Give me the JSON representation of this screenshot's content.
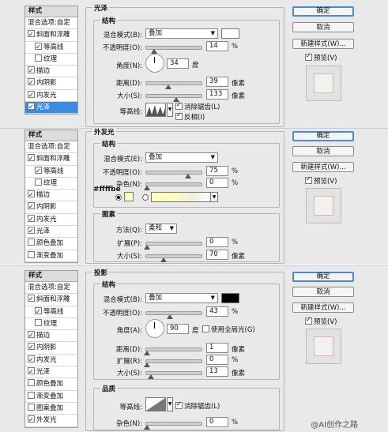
{
  "panel1": {
    "styles_title": "样式",
    "blend_options": "混合选项:自定",
    "items": [
      {
        "label": "斜面和浮雕",
        "checked": true
      },
      {
        "label": "等高线",
        "checked": true
      },
      {
        "label": "纹理",
        "checked": false
      },
      {
        "label": "描边",
        "checked": true
      },
      {
        "label": "内阴影",
        "checked": true
      },
      {
        "label": "内发光",
        "checked": true
      },
      {
        "label": "光泽",
        "checked": true,
        "selected": true
      }
    ],
    "section": "光泽",
    "group": "结构",
    "blend_mode_label": "混合模式(B):",
    "blend_mode": "叠加",
    "opacity_label": "不透明度(O):",
    "opacity": "14",
    "angle_label": "角度(N):",
    "angle": "34",
    "angle_unit": "度",
    "distance_label": "距离(D):",
    "distance": "39",
    "size_label": "大小(S):",
    "size": "133",
    "px_unit": "像素",
    "pct_unit": "%",
    "contour_label": "等高线:",
    "antialias": "消除锯齿(L)",
    "invert": "反相(I)"
  },
  "panel2": {
    "styles_title": "样式",
    "blend_options": "混合选项:自定",
    "items": [
      {
        "label": "斜面和浮雕",
        "checked": true
      },
      {
        "label": "等高线",
        "checked": true
      },
      {
        "label": "纹理",
        "checked": false
      },
      {
        "label": "描边",
        "checked": true
      },
      {
        "label": "内阴影",
        "checked": true
      },
      {
        "label": "内发光",
        "checked": true
      },
      {
        "label": "光泽",
        "checked": true
      },
      {
        "label": "颜色叠加",
        "checked": false
      },
      {
        "label": "渐变叠加",
        "checked": false
      }
    ],
    "section": "外发光",
    "group": "结构",
    "blend_mode_label": "混合模式(E):",
    "blend_mode": "叠加",
    "opacity_label": "不透明度(O):",
    "opacity": "75",
    "noise_label": "杂色(N):",
    "noise": "0",
    "hex": "#ffffbe",
    "group2": "图素",
    "method_label": "方法(Q):",
    "method": "柔和",
    "spread_label": "扩展(P):",
    "spread": "0",
    "size_label": "大小(S):",
    "size": "70",
    "px_unit": "像素",
    "pct_unit": "%"
  },
  "panel3": {
    "styles_title": "样式",
    "blend_options": "混合选项:自定",
    "items": [
      {
        "label": "斜面和浮雕",
        "checked": true
      },
      {
        "label": "等高线",
        "checked": true
      },
      {
        "label": "纹理",
        "checked": false
      },
      {
        "label": "描边",
        "checked": true
      },
      {
        "label": "内阴影",
        "checked": true
      },
      {
        "label": "内发光",
        "checked": true
      },
      {
        "label": "光泽",
        "checked": true
      },
      {
        "label": "颜色叠加",
        "checked": false
      },
      {
        "label": "渐变叠加",
        "checked": false
      },
      {
        "label": "图案叠加",
        "checked": false
      },
      {
        "label": "外发光",
        "checked": true
      }
    ],
    "section": "投影",
    "group": "结构",
    "blend_mode_label": "混合模式(B):",
    "blend_mode": "叠加",
    "opacity_label": "不透明度(O):",
    "opacity": "43",
    "angle_label": "角度(A):",
    "angle": "90",
    "angle_unit": "度",
    "global_light": "使用全局光(G)",
    "distance_label": "距离(D):",
    "distance": "1",
    "spread_label": "扩展(R):",
    "spread": "0",
    "size_label": "大小(S):",
    "size": "13",
    "group2": "品质",
    "contour_label": "等高线:",
    "antialias": "消除锯齿(L)",
    "noise_label": "杂色(N):",
    "noise": "0",
    "px_unit": "像素",
    "pct_unit": "%"
  },
  "buttons": {
    "ok": "确定",
    "cancel": "取消",
    "new_style": "新建样式(W)...",
    "preview": "预览(V)"
  },
  "colors": {
    "gloss_color": "#ffffff",
    "glow_color": "#ffffbe",
    "shadow_color": "#000000",
    "selected_bg": "#3b8be3"
  },
  "watermark": "@AI创作之路"
}
